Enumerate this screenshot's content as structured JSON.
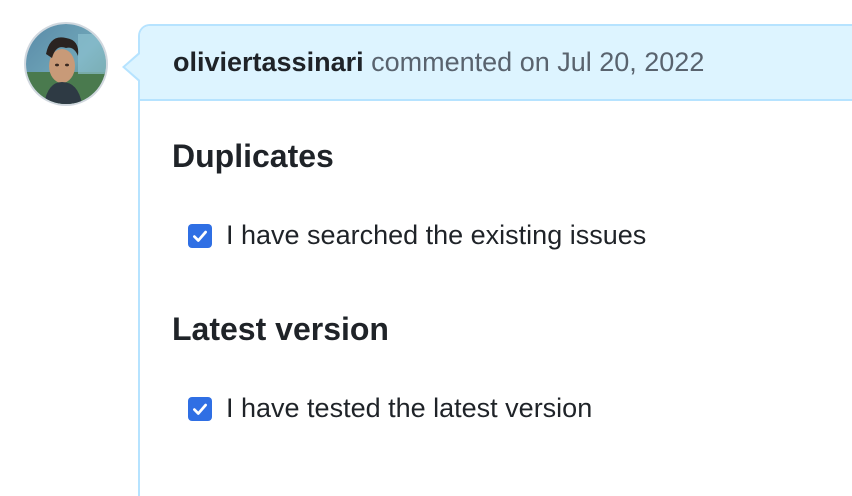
{
  "comment": {
    "author": "oliviertassinari",
    "action_text": "commented on Jul 20, 2022"
  },
  "sections": [
    {
      "title": "Duplicates",
      "tasks": [
        {
          "label": "I have searched the existing issues",
          "checked": true
        }
      ]
    },
    {
      "title": "Latest version",
      "tasks": [
        {
          "label": "I have tested the latest version",
          "checked": true
        }
      ]
    }
  ],
  "colors": {
    "header_bg": "#ddf4ff",
    "border": "#b6e3ff",
    "checkbox": "#2f6fe4"
  },
  "icons": {
    "avatar": "user-avatar-photo",
    "check": "checkmark-icon"
  }
}
